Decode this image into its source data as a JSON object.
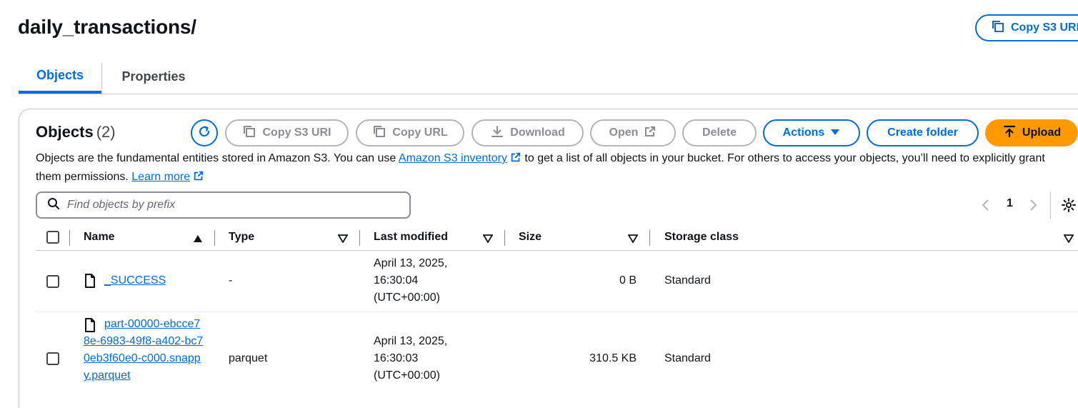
{
  "page": {
    "title": "daily_transactions/",
    "copy_s3_uri_top": "Copy S3 URI"
  },
  "tabs": [
    {
      "label": "Objects",
      "active": true
    },
    {
      "label": "Properties",
      "active": false
    }
  ],
  "objects_panel": {
    "heading": "Objects",
    "count": "(2)",
    "buttons": {
      "copy_s3_uri": "Copy S3 URI",
      "copy_url": "Copy URL",
      "download": "Download",
      "open": "Open",
      "delete": "Delete",
      "actions": "Actions",
      "create_folder": "Create folder",
      "upload": "Upload"
    },
    "description_part1": "Objects are the fundamental entities stored in Amazon S3. You can use",
    "description_link1": "Amazon S3 inventory",
    "description_part2": "to get a list of all objects in your bucket. For others to access your objects, you’ll need to explicitly grant them permissions.",
    "description_link2": "Learn more",
    "search_placeholder": "Find objects by prefix",
    "current_page": "1"
  },
  "table": {
    "columns": [
      "Name",
      "Type",
      "Last modified",
      "Size",
      "Storage class"
    ],
    "rows": [
      {
        "name": "_SUCCESS",
        "type": "-",
        "last_modified": "April 13, 2025, 16:30:04 (UTC+00:00)",
        "size": "0 B",
        "storage_class": "Standard"
      },
      {
        "name": "part-00000-ebcce78e-6983-49f8-a402-bc70eb3f60e0-c000.snappy.parquet",
        "type": "parquet",
        "last_modified": "April 13, 2025, 16:30:03 (UTC+00:00)",
        "size": "310.5 KB",
        "storage_class": "Standard"
      }
    ]
  },
  "colors": {
    "primary": "#006ce0",
    "upload": "#ff9900",
    "disabled": "#8c8c94"
  }
}
